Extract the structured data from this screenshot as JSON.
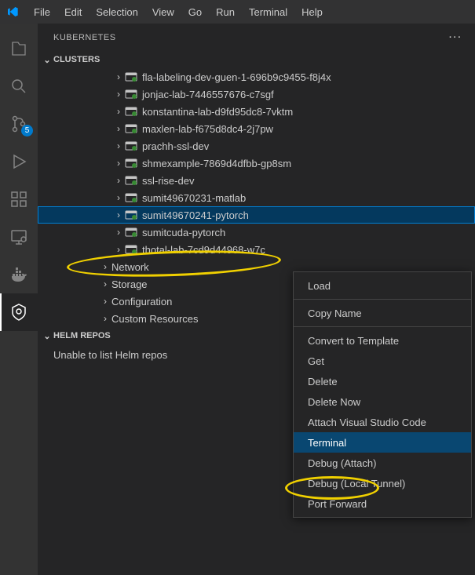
{
  "menu": [
    "File",
    "Edit",
    "Selection",
    "View",
    "Go",
    "Run",
    "Terminal",
    "Help"
  ],
  "scm_badge": "5",
  "sidebar_title": "KUBERNETES",
  "sections": {
    "clusters": "CLUSTERS",
    "helm": "HELM REPOS"
  },
  "pods": [
    "fla-labeling-dev-guen-1-696b9c9455-f8j4x",
    "jonjac-lab-7446557676-c7sgf",
    "konstantina-lab-d9fd95dc8-7vktm",
    "maxlen-lab-f675d8dc4-2j7pw",
    "prachh-ssl-dev",
    "shmexample-7869d4dfbb-gp8sm",
    "ssl-rise-dev",
    "sumit49670231-matlab",
    "sumit49670241-pytorch",
    "sumitcuda-pytorch",
    "thotal-lab-7cd9d44968-w7c"
  ],
  "selected_pod_index": 8,
  "nodes": [
    "Network",
    "Storage",
    "Configuration",
    "Custom Resources"
  ],
  "helm_msg": "Unable to list Helm repos",
  "ctx": {
    "load": "Load",
    "copy": "Copy Name",
    "convert": "Convert to Template",
    "get": "Get",
    "delete": "Delete",
    "deletenow": "Delete Now",
    "attach": "Attach Visual Studio Code",
    "terminal": "Terminal",
    "debug_attach": "Debug (Attach)",
    "debug_tunnel": "Debug (Local Tunnel)",
    "port": "Port Forward"
  }
}
